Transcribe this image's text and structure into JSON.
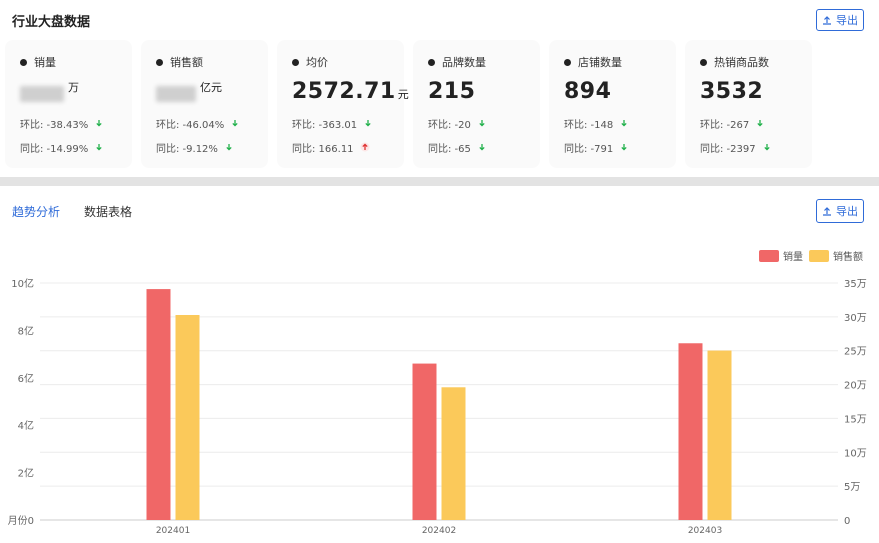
{
  "header": {
    "title": "行业大盘数据",
    "export_label": "导出"
  },
  "cards": [
    {
      "label": "销量",
      "value": "",
      "blurred": true,
      "unit": "万",
      "rows": [
        {
          "text": "环比: -38.43%",
          "dir": "down"
        },
        {
          "text": "同比: -14.99%",
          "dir": "down"
        }
      ]
    },
    {
      "label": "销售额",
      "value": "",
      "blurred": true,
      "unit": "亿元",
      "rows": [
        {
          "text": "环比: -46.04%",
          "dir": "down"
        },
        {
          "text": "同比: -9.12%",
          "dir": "down"
        }
      ]
    },
    {
      "label": "均价",
      "value": "2572.71",
      "blurred": false,
      "unit": "元",
      "rows": [
        {
          "text": "环比: -363.01",
          "dir": "down"
        },
        {
          "text": "同比: 166.11",
          "dir": "up"
        }
      ]
    },
    {
      "label": "品牌数量",
      "value": "215",
      "blurred": false,
      "unit": "",
      "rows": [
        {
          "text": "环比: -20",
          "dir": "down"
        },
        {
          "text": "同比: -65",
          "dir": "down"
        }
      ]
    },
    {
      "label": "店铺数量",
      "value": "894",
      "blurred": false,
      "unit": "",
      "rows": [
        {
          "text": "环比: -148",
          "dir": "down"
        },
        {
          "text": "同比: -791",
          "dir": "down"
        }
      ]
    },
    {
      "label": "热销商品数",
      "value": "3532",
      "blurred": false,
      "unit": "",
      "rows": [
        {
          "text": "环比: -267",
          "dir": "down"
        },
        {
          "text": "同比: -2397",
          "dir": "down"
        }
      ]
    }
  ],
  "tabs": [
    {
      "label": "趋势分析",
      "active": true
    },
    {
      "label": "数据表格",
      "active": false
    }
  ],
  "bottom_export_label": "导出",
  "colors": {
    "accent": "#2f6bd8",
    "down": "#22b14c",
    "up": "#e03434",
    "series1": "#f06767",
    "series2": "#fbc95a"
  },
  "chart_data": {
    "type": "bar",
    "categories": [
      "202401",
      "202402",
      "202403"
    ],
    "series": [
      {
        "name": "销量",
        "axis": "right",
        "values": [
          34.1,
          23.1,
          26.1
        ]
      },
      {
        "name": "销售额",
        "axis": "left",
        "values": [
          8.65,
          5.6,
          7.15
        ]
      }
    ],
    "left_axis": {
      "ticks": [
        "月份0",
        "2亿",
        "4亿",
        "6亿",
        "8亿",
        "10亿"
      ],
      "values": [
        0,
        2,
        4,
        6,
        8,
        10
      ],
      "ylim": [
        0,
        10
      ]
    },
    "right_axis": {
      "ticks": [
        "0",
        "5万",
        "10万",
        "15万",
        "20万",
        "25万",
        "30万",
        "35万"
      ],
      "values": [
        0,
        5,
        10,
        15,
        20,
        25,
        30,
        35
      ],
      "ylim": [
        0,
        35
      ]
    },
    "legend_position": "top-right",
    "grid": true
  }
}
